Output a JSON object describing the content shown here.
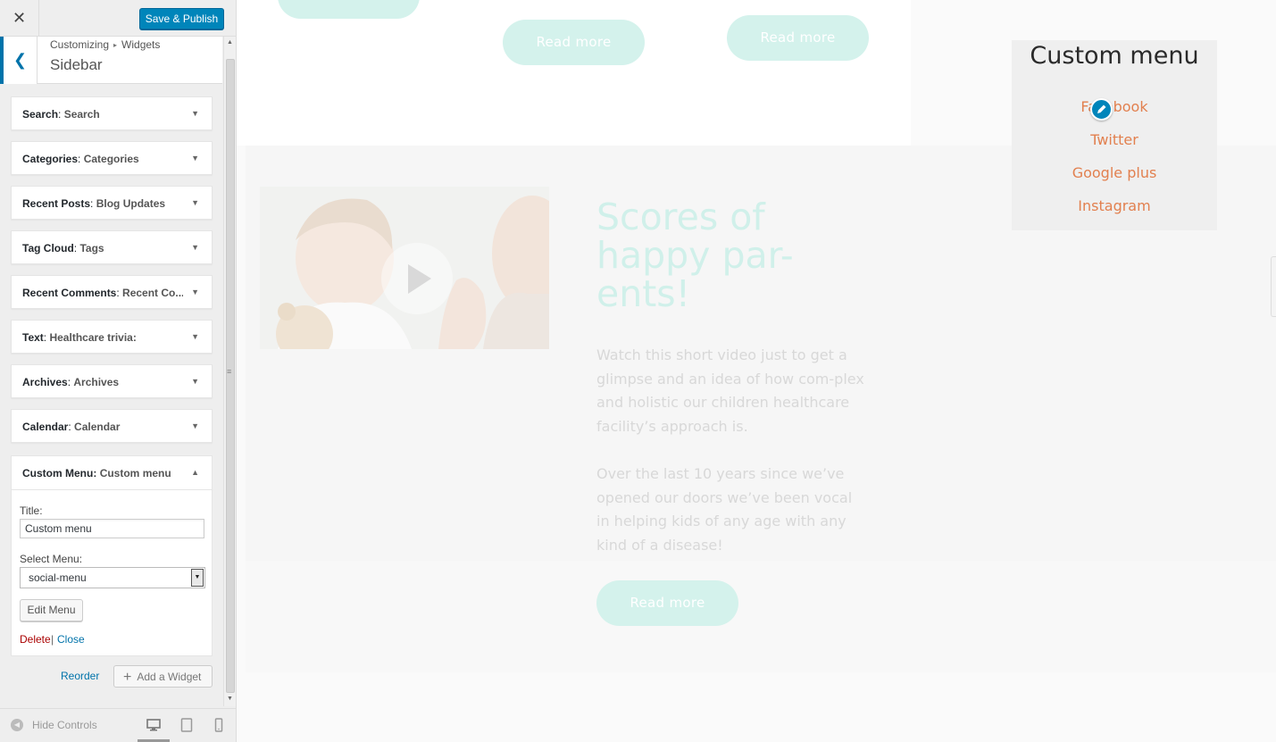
{
  "customizer": {
    "close_label": "✕",
    "publish_label": "Save & Publish",
    "breadcrumb": {
      "part1": "Customizing",
      "separator": "▸",
      "part2": "Widgets"
    },
    "section_title": "Sidebar",
    "widgets": [
      {
        "type": "Search",
        "instance": "Search"
      },
      {
        "type": "Categories",
        "instance": "Categories"
      },
      {
        "type": "Recent Posts",
        "instance": "Blog Updates"
      },
      {
        "type": "Tag Cloud",
        "instance": "Tags"
      },
      {
        "type": "Recent Comments",
        "instance": "Recent Co..."
      },
      {
        "type": "Text",
        "instance": "Healthcare trivia:"
      },
      {
        "type": "Archives",
        "instance": "Archives"
      },
      {
        "type": "Calendar",
        "instance": "Calendar"
      }
    ],
    "expanded_widget": {
      "type": "Custom Menu",
      "instance": "Custom menu",
      "title_label": "Title:",
      "title_value": "Custom menu",
      "select_label": "Select Menu:",
      "select_value": "social-menu",
      "edit_menu_label": "Edit Menu",
      "delete_label": "Delete",
      "separator": "|",
      "close_label": "Close"
    },
    "reorder_label": "Reorder",
    "add_widget_label": "Add a Widget",
    "hide_controls_label": "Hide Controls",
    "devices": [
      "desktop-icon",
      "tablet-icon",
      "mobile-icon"
    ]
  },
  "preview": {
    "top_buttons": [
      "Read more",
      "Read more"
    ],
    "heading": "Scores of happy par-ents!",
    "paragraph1": "Watch this short video just to get a glimpse and an idea of how com-plex and holistic our children healthcare facility’s approach is.",
    "paragraph2": "Over the last 10 years since we’ve opened our doors we’ve been vocal in helping kids of any age with any kind of a disease!",
    "cta_label": "Read more",
    "custom_menu": {
      "title": "Custom menu",
      "items": [
        "Facebook",
        "Twitter",
        "Google plus",
        "Instagram"
      ]
    }
  },
  "colors": {
    "accent": "#0085ba",
    "link": "#0073aa",
    "delete": "#aa0000",
    "pill": "#d4f2ec",
    "menu_link": "#e2804f"
  }
}
